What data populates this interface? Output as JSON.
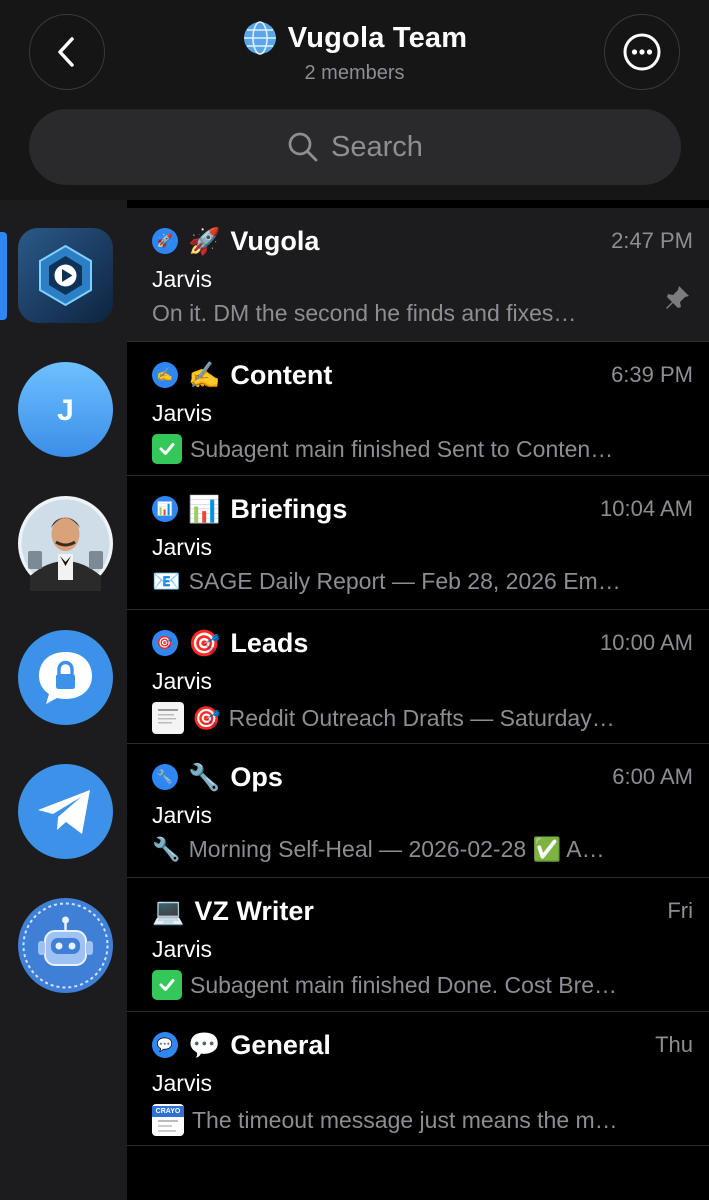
{
  "header": {
    "title": "Vugola Team",
    "subtitle": "2 members",
    "back_icon": "chevron-left-icon",
    "more_icon": "ellipsis-icon",
    "globe_icon": "globe-icon"
  },
  "search": {
    "placeholder": "Search"
  },
  "sidebar": {
    "items": [
      {
        "icon": "hexagon-play-icon",
        "active": true
      },
      {
        "letter": "J",
        "icon": "avatar-j"
      },
      {
        "icon": "avatar-portrait"
      },
      {
        "icon": "lock-chat-icon"
      },
      {
        "icon": "telegram-plane-icon"
      },
      {
        "icon": "robot-icon"
      }
    ]
  },
  "chats": [
    {
      "emoji": "🚀",
      "name": "Vugola",
      "time": "2:47 PM",
      "sender": "Jarvis",
      "preview": "On it. DM the second he finds and fixes…",
      "pinned": true
    },
    {
      "emoji": "✍️",
      "name": "Content",
      "time": "6:39 PM",
      "sender": "Jarvis",
      "preview_prefix": "✅",
      "preview": "Subagent main finished Sent to Conten…"
    },
    {
      "emoji": "📊",
      "name": "Briefings",
      "time": "10:04 AM",
      "sender": "Jarvis",
      "preview_prefix": "📧",
      "preview": "SAGE Daily Report — Feb 28, 2026 Em…"
    },
    {
      "emoji": "🎯",
      "name": "Leads",
      "time": "10:00 AM",
      "sender": "Jarvis",
      "preview_prefix": "🎯",
      "preview": "Reddit Outreach Drafts — Saturday…"
    },
    {
      "emoji": "🔧",
      "name": "Ops",
      "time": "6:00 AM",
      "sender": "Jarvis",
      "preview_prefix": "🔧",
      "preview": "Morning Self-Heal — 2026-02-28 ✅ A…"
    },
    {
      "emoji": "💻",
      "name": "VZ Writer",
      "time": "Fri",
      "sender": "Jarvis",
      "preview_prefix": "✅",
      "preview": "Subagent main finished Done. Cost Bre…"
    },
    {
      "emoji": "💬",
      "name": "General",
      "time": "Thu",
      "sender": "Jarvis",
      "preview_prefix": "CRAYO",
      "preview": "The timeout message just means the m…"
    }
  ],
  "colors": {
    "accent": "#2f87f5",
    "check": "#34c759",
    "muted": "#8d8d93"
  }
}
